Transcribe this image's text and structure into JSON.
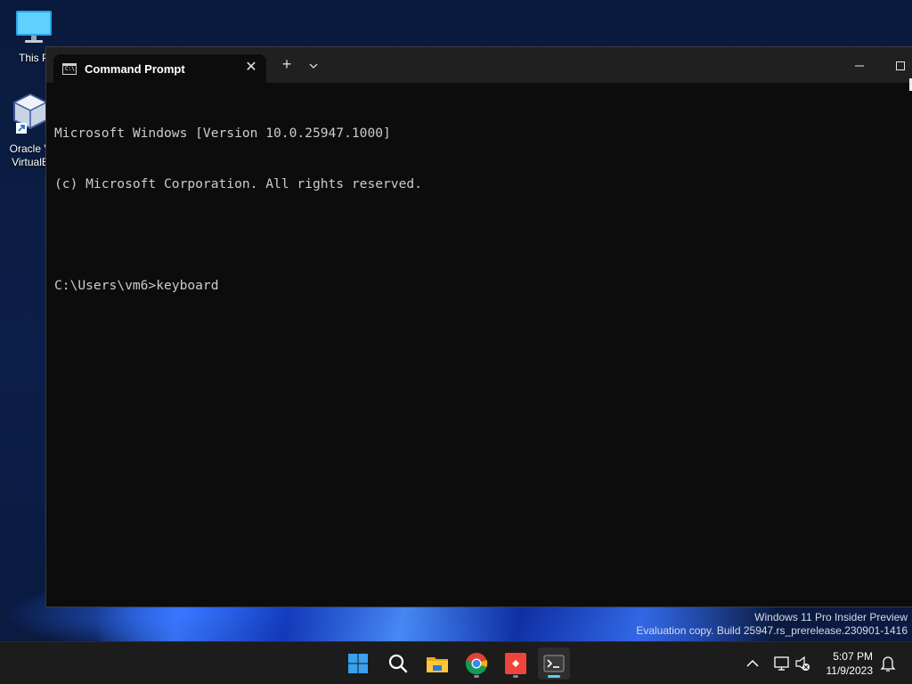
{
  "desktop": {
    "icons": [
      {
        "label": "This P"
      },
      {
        "label_line1": "Oracle V",
        "label_line2": "VirtualB"
      }
    ],
    "watermark": {
      "line1": "Windows 11 Pro Insider Preview",
      "line2": "Evaluation copy. Build 25947.rs_prerelease.230901-1416"
    }
  },
  "terminal": {
    "tab_title": "Command Prompt",
    "tab_icon_text": "C:\\",
    "new_tab_label": "+",
    "dropdown_label": "⌄",
    "close_tab_label": "✕",
    "minimize_label": "—",
    "maximize_label": "☐",
    "lines": [
      "Microsoft Windows [Version 10.0.25947.1000]",
      "(c) Microsoft Corporation. All rights reserved.",
      "",
      "C:\\Users\\vm6>keyboard"
    ]
  },
  "taskbar": {
    "apps": [
      {
        "name": "start",
        "icon": "windows-logo-icon"
      },
      {
        "name": "search",
        "icon": "search-icon"
      },
      {
        "name": "file-explorer",
        "icon": "folder-icon"
      },
      {
        "name": "chrome",
        "icon": "chrome-icon"
      },
      {
        "name": "anydesk",
        "icon": "anydesk-icon"
      },
      {
        "name": "terminal",
        "icon": "terminal-icon"
      }
    ],
    "clock": {
      "time": "5:07 PM",
      "date": "11/9/2023"
    },
    "colors": {
      "accent": "#60cdff",
      "taskbar": "#1c1c1c"
    }
  }
}
